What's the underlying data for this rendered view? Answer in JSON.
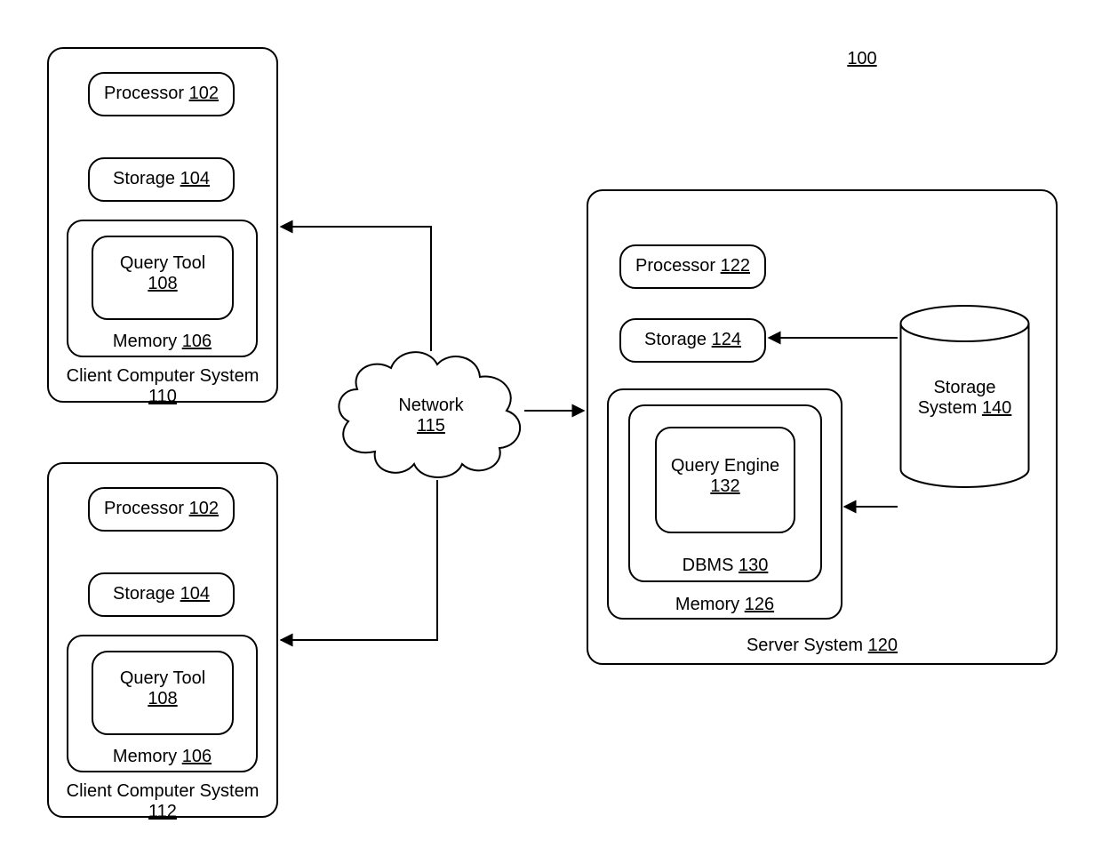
{
  "figure": {
    "ref": "100"
  },
  "network": {
    "name": "Network",
    "ref": "115"
  },
  "client1": {
    "title": "Client Computer System",
    "ref": "110",
    "processor": {
      "name": "Processor",
      "ref": "102"
    },
    "storage": {
      "name": "Storage",
      "ref": "104"
    },
    "memory": {
      "name": "Memory",
      "ref": "106"
    },
    "querytool": {
      "name": "Query Tool",
      "ref": "108"
    }
  },
  "client2": {
    "title": "Client Computer System",
    "ref": "112",
    "processor": {
      "name": "Processor",
      "ref": "102"
    },
    "storage": {
      "name": "Storage",
      "ref": "104"
    },
    "memory": {
      "name": "Memory",
      "ref": "106"
    },
    "querytool": {
      "name": "Query Tool",
      "ref": "108"
    }
  },
  "server": {
    "title": "Server System",
    "ref": "120",
    "processor": {
      "name": "Processor",
      "ref": "122"
    },
    "storage": {
      "name": "Storage",
      "ref": "124"
    },
    "memory": {
      "name": "Memory",
      "ref": "126"
    },
    "dbms": {
      "name": "DBMS",
      "ref": "130"
    },
    "queryengine": {
      "name": "Query Engine",
      "ref": "132"
    }
  },
  "storage_system": {
    "name1": "Storage",
    "name2": "System",
    "ref": "140"
  }
}
